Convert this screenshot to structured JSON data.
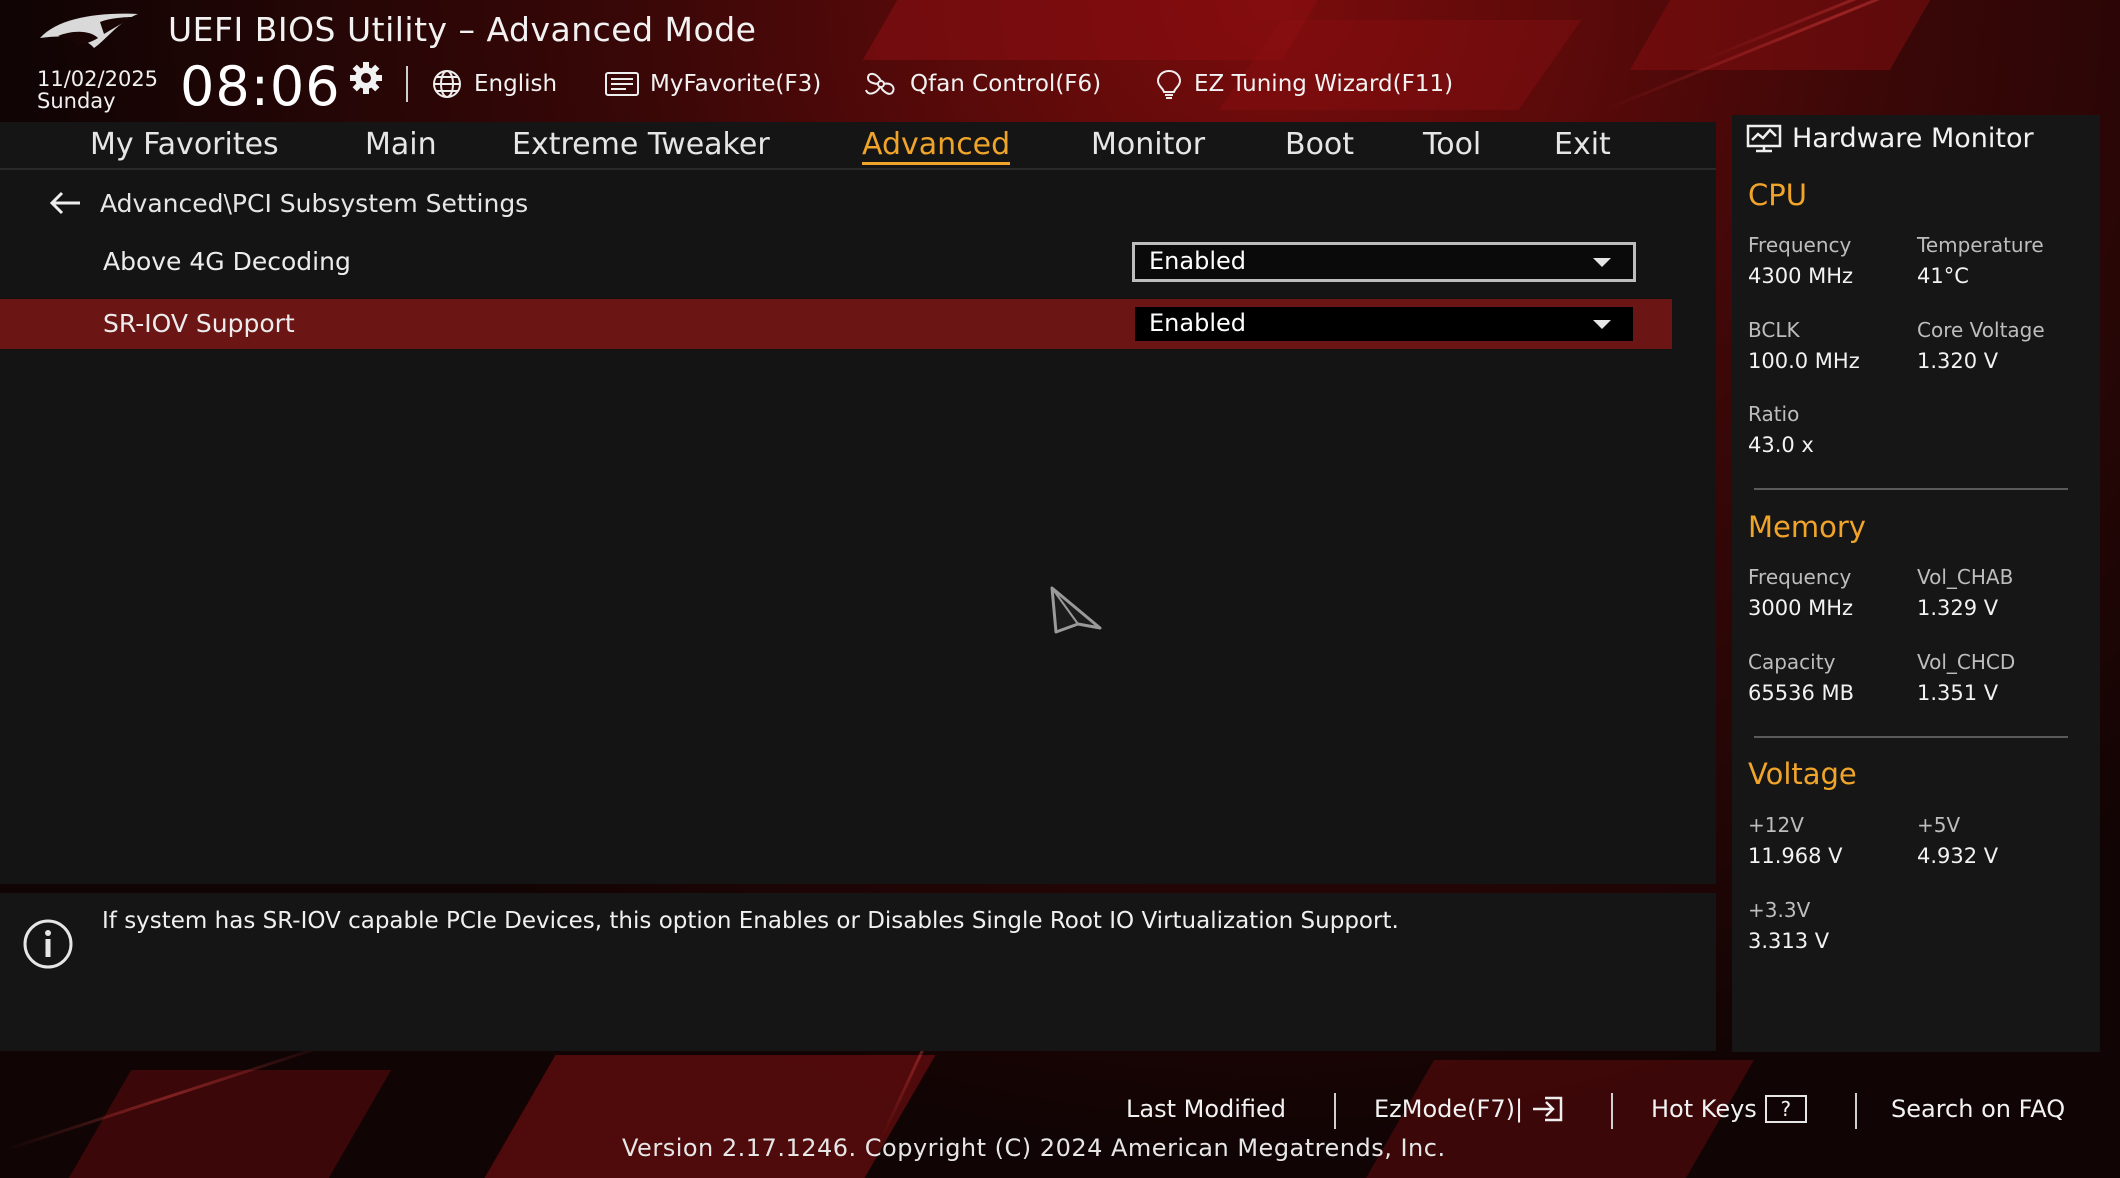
{
  "header": {
    "title": "UEFI BIOS Utility – Advanced Mode",
    "date": "11/02/2025",
    "day": "Sunday",
    "time": "08:06",
    "toolbar": [
      {
        "label": "English",
        "icon": "globe-icon"
      },
      {
        "label": "MyFavorite(F3)",
        "icon": "favorite-icon"
      },
      {
        "label": "Qfan Control(F6)",
        "icon": "fan-icon"
      },
      {
        "label": "EZ Tuning Wizard(F11)",
        "icon": "bulb-icon"
      }
    ]
  },
  "tabs": [
    {
      "label": "My Favorites"
    },
    {
      "label": "Main"
    },
    {
      "label": "Extreme Tweaker"
    },
    {
      "label": "Advanced",
      "active": true
    },
    {
      "label": "Monitor"
    },
    {
      "label": "Boot"
    },
    {
      "label": "Tool"
    },
    {
      "label": "Exit"
    }
  ],
  "breadcrumb": "Advanced\\PCI Subsystem Settings",
  "settings": [
    {
      "label": "Above 4G Decoding",
      "value": "Enabled"
    },
    {
      "label": "SR-IOV Support",
      "value": "Enabled",
      "selected": true
    }
  ],
  "help_text": "If system has SR-IOV capable PCIe Devices, this option Enables or Disables Single Root IO Virtualization Support.",
  "hardware_monitor": {
    "title": "Hardware Monitor",
    "cpu": {
      "heading": "CPU",
      "frequency_label": "Frequency",
      "frequency": "4300 MHz",
      "temperature_label": "Temperature",
      "temperature": "41°C",
      "bclk_label": "BCLK",
      "bclk": "100.0 MHz",
      "core_voltage_label": "Core Voltage",
      "core_voltage": "1.320 V",
      "ratio_label": "Ratio",
      "ratio": "43.0 x"
    },
    "memory": {
      "heading": "Memory",
      "frequency_label": "Frequency",
      "frequency": "3000 MHz",
      "vol_chab_label": "Vol_CHAB",
      "vol_chab": "1.329 V",
      "capacity_label": "Capacity",
      "capacity": "65536 MB",
      "vol_chcd_label": "Vol_CHCD",
      "vol_chcd": "1.351 V"
    },
    "voltage": {
      "heading": "Voltage",
      "v12_label": "+12V",
      "v12": "11.968 V",
      "v5_label": "+5V",
      "v5": "4.932 V",
      "v33_label": "+3.3V",
      "v33": "3.313 V"
    }
  },
  "footer": {
    "last_modified": "Last Modified",
    "ezmode": "EzMode(F7)|",
    "hot_keys": "Hot Keys",
    "hot_keys_key": "?",
    "search_faq": "Search on FAQ",
    "version": "Version 2.17.1246. Copyright (C) 2024 American Megatrends, Inc."
  },
  "colors": {
    "accent": "#f0a42a",
    "selection": "#6b1515",
    "background_red": "#7a0c0c"
  }
}
